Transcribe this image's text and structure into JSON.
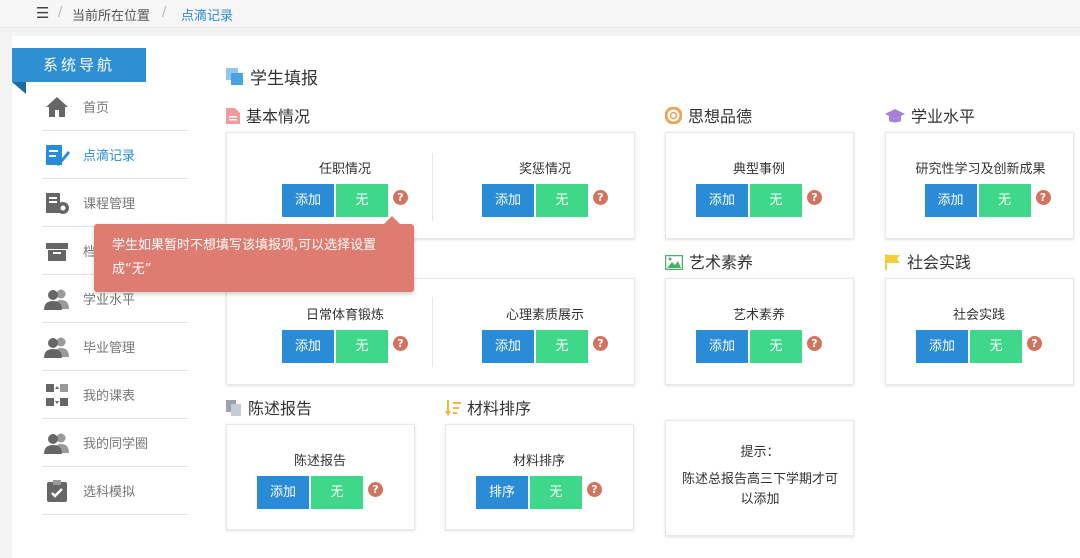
{
  "breadcrumb": {
    "current_location": "当前所在位置",
    "page": "点滴记录"
  },
  "sidebar": {
    "title": "系统导航",
    "items": [
      {
        "label": "首页",
        "icon": "home-icon"
      },
      {
        "label": "点滴记录",
        "icon": "edit-icon"
      },
      {
        "label": "课程管理",
        "icon": "course-icon"
      },
      {
        "label": "档",
        "icon": "archive-icon"
      },
      {
        "label": "学业水平",
        "icon": "users-icon"
      },
      {
        "label": "毕业管理",
        "icon": "users-icon"
      },
      {
        "label": "我的课表",
        "icon": "swap-icon"
      },
      {
        "label": "我的同学圈",
        "icon": "users-icon"
      },
      {
        "label": "选科模拟",
        "icon": "clipboard-icon"
      }
    ]
  },
  "main": {
    "page_title": "学生填报",
    "sections": {
      "basic": "基本情况",
      "morality": "思想品德",
      "academic": "学业水平",
      "art": "艺术素养",
      "social": "社会实践",
      "report": "陈述报告",
      "sort": "材料排序"
    },
    "items": {
      "appointment": "任职情况",
      "rewards": "奖惩情况",
      "typical_case": "典型事例",
      "research": "研究性学习及创新成果",
      "exercise": "日常体育锻炼",
      "psych": "心理素质展示",
      "art": "艺术素养",
      "social": "社会实践",
      "report": "陈述报告",
      "sort": "材料排序"
    },
    "buttons": {
      "add": "添加",
      "none": "无",
      "sort": "排序",
      "help": "?"
    },
    "tooltip": "学生如果暂时不想填写该填报项,可以选择设置成“无”",
    "tip": {
      "title": "提示：",
      "body": "陈述总报告高三下学期才可以添加"
    }
  },
  "colors": {
    "primary": "#2a8cd6",
    "success": "#3fd78a",
    "tooltip": "#df7c72",
    "help": "#d2735f"
  }
}
